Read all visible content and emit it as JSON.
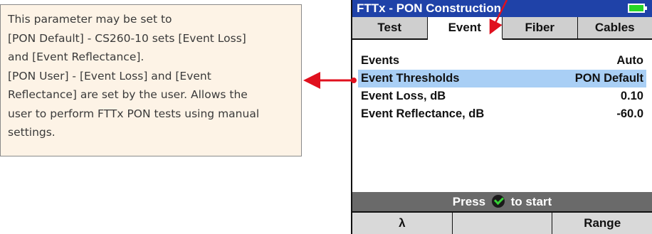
{
  "callout": {
    "lines": [
      "This parameter may be set to",
      "[PON Default] - CS260-10 sets [Event Loss]",
      "and [Event Reflectance].",
      "[PON User] - [Event Loss] and [Event",
      "Reflectance] are set by the user. Allows the",
      "user to perform FTTx PON tests using manual",
      "settings."
    ]
  },
  "device": {
    "title": "FTTx - PON Construction",
    "tabs": [
      "Test",
      "Event",
      "Fiber",
      "Cables"
    ],
    "active_tab": "Event",
    "rows": [
      {
        "label": "Events",
        "value": "Auto"
      },
      {
        "label": "Event Thresholds",
        "value": "PON Default"
      },
      {
        "label": "Event Loss, dB",
        "value": "0.10"
      },
      {
        "label": "Event Reflectance, dB",
        "value": "-60.0"
      }
    ],
    "status": {
      "prefix": "Press",
      "suffix": "to start",
      "icon": "check-icon"
    },
    "softkeys": [
      "λ",
      "",
      "Range"
    ]
  },
  "colors": {
    "title_bar": "#1f42a8",
    "selected_row": "#a9cff5",
    "status_bar": "#6a6a6a",
    "arrow": "#e0101e",
    "callout_bg": "#fdf3e6",
    "battery": "#27d627"
  }
}
